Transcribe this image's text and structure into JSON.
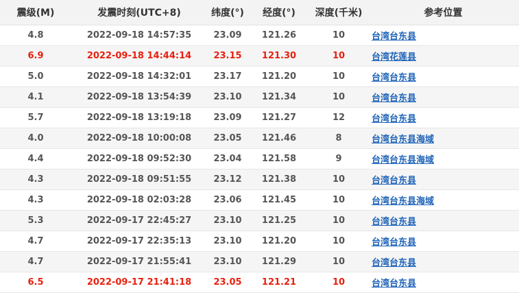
{
  "headers": {
    "magnitude": "震级(M)",
    "time": "发震时刻(UTC+8)",
    "latitude": "纬度(°)",
    "longitude": "经度(°)",
    "depth": "深度(千米)",
    "location": "参考位置"
  },
  "colors": {
    "major": "#e8200f",
    "link": "#1e63b8",
    "header_bg": "#f3f3f3",
    "stripe_bg": "#f5f5f5"
  },
  "rows": [
    {
      "mag": "4.8",
      "time": "2022-09-18 14:57:35",
      "lat": "23.09",
      "lon": "121.26",
      "depth": "10",
      "loc": "台湾台东县",
      "major": false
    },
    {
      "mag": "6.9",
      "time": "2022-09-18 14:44:14",
      "lat": "23.15",
      "lon": "121.30",
      "depth": "10",
      "loc": "台湾花莲县",
      "major": true
    },
    {
      "mag": "5.0",
      "time": "2022-09-18 14:32:01",
      "lat": "23.17",
      "lon": "121.20",
      "depth": "10",
      "loc": "台湾台东县",
      "major": false
    },
    {
      "mag": "4.1",
      "time": "2022-09-18 13:54:39",
      "lat": "23.10",
      "lon": "121.34",
      "depth": "10",
      "loc": "台湾台东县",
      "major": false
    },
    {
      "mag": "5.7",
      "time": "2022-09-18 13:19:18",
      "lat": "23.09",
      "lon": "121.27",
      "depth": "12",
      "loc": "台湾台东县",
      "major": false
    },
    {
      "mag": "4.0",
      "time": "2022-09-18 10:00:08",
      "lat": "23.05",
      "lon": "121.46",
      "depth": "8",
      "loc": "台湾台东县海域",
      "major": false
    },
    {
      "mag": "4.4",
      "time": "2022-09-18 09:52:30",
      "lat": "23.04",
      "lon": "121.58",
      "depth": "9",
      "loc": "台湾台东县海域",
      "major": false
    },
    {
      "mag": "4.3",
      "time": "2022-09-18 09:51:55",
      "lat": "23.12",
      "lon": "121.38",
      "depth": "10",
      "loc": "台湾台东县",
      "major": false
    },
    {
      "mag": "4.3",
      "time": "2022-09-18 02:03:28",
      "lat": "23.06",
      "lon": "121.45",
      "depth": "10",
      "loc": "台湾台东县海域",
      "major": false
    },
    {
      "mag": "5.3",
      "time": "2022-09-17 22:45:27",
      "lat": "23.10",
      "lon": "121.25",
      "depth": "10",
      "loc": "台湾台东县",
      "major": false
    },
    {
      "mag": "4.7",
      "time": "2022-09-17 22:35:13",
      "lat": "23.10",
      "lon": "121.20",
      "depth": "10",
      "loc": "台湾台东县",
      "major": false
    },
    {
      "mag": "4.7",
      "time": "2022-09-17 21:55:41",
      "lat": "23.10",
      "lon": "121.29",
      "depth": "10",
      "loc": "台湾台东县",
      "major": false
    },
    {
      "mag": "6.5",
      "time": "2022-09-17 21:41:18",
      "lat": "23.05",
      "lon": "121.21",
      "depth": "10",
      "loc": "台湾台东县",
      "major": true
    }
  ]
}
